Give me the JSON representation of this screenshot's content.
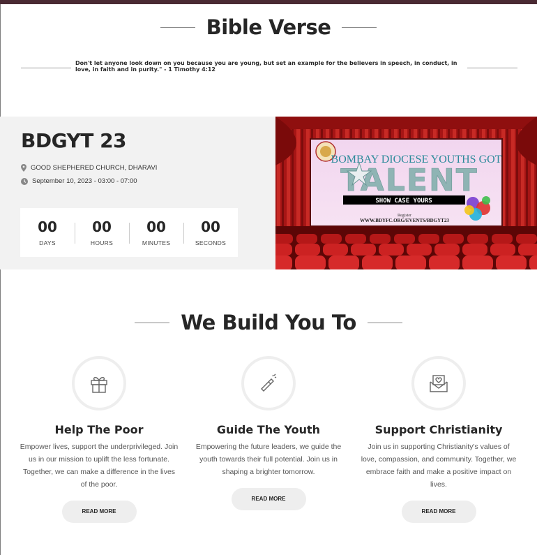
{
  "bible": {
    "heading": "Bible Verse",
    "verse": "Don't let anyone look down on you because you are young, but set an example for the believers in speech, in conduct, in love, in faith and in purity.\" - 1 Timothy 4:12"
  },
  "event": {
    "title": "BDGYT 23",
    "location": "GOOD SHEPHERED CHURCH, DHARAVI",
    "datetime": "September 10, 2023 - 03:00 - 07:00",
    "countdown": [
      {
        "value": "00",
        "label": "DAYS"
      },
      {
        "value": "00",
        "label": "HOURS"
      },
      {
        "value": "00",
        "label": "MINUTES"
      },
      {
        "value": "00",
        "label": "SECONDS"
      }
    ],
    "poster": {
      "line1": "BOMBAY DIOCESE YOUTHS GOT",
      "line2": "TALENT",
      "line3": "SHOW CASE YOURS",
      "register": "Register",
      "url": "WWW.BDYFC.ORG/EVENTS/BDGYT23"
    }
  },
  "build": {
    "heading": "We Build You To",
    "cards": [
      {
        "icon": "gift-icon",
        "title": "Help The Poor",
        "text": "Empower lives, support the underprivileged. Join us in our mission to uplift the less fortunate. Together, we can make a difference in the lives of the poor.",
        "button": "READ MORE"
      },
      {
        "icon": "champagne-icon",
        "title": "Guide The Youth",
        "text": "Empowering the future leaders, we guide the youth towards their full potential. Join us in shaping a brighter tomorrow.",
        "button": "READ MORE"
      },
      {
        "icon": "love-letter-icon",
        "title": "Support Christianity",
        "text": "Join us in supporting Christianity's values of love, compassion, and community. Together, we embrace faith and make a positive impact on lives.",
        "button": "READ MORE"
      }
    ]
  },
  "colors": {
    "topbar": "#4a2a33",
    "band": "#f2f2f2",
    "heading": "#262626",
    "button_bg": "#eeeeee"
  }
}
